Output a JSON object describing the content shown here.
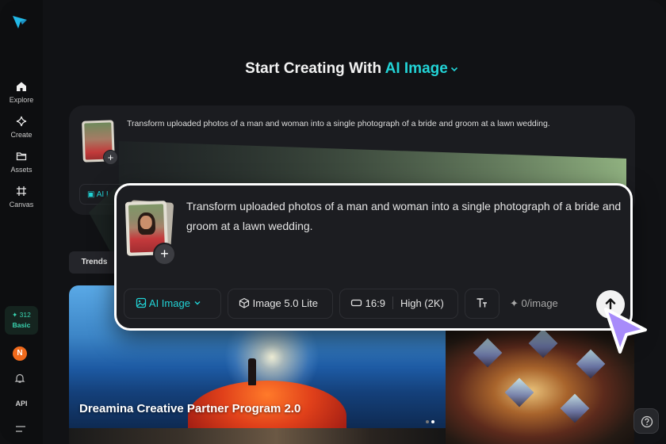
{
  "sidebar": {
    "items": [
      {
        "label": "Explore",
        "icon": "home-icon"
      },
      {
        "label": "Create",
        "icon": "sparkle-icon"
      },
      {
        "label": "Assets",
        "icon": "folder-icon"
      },
      {
        "label": "Canvas",
        "icon": "canvas-icon"
      }
    ],
    "credits": {
      "amount": "312",
      "plan": "Basic"
    },
    "avatar_initial": "N",
    "api_label": "API"
  },
  "header": {
    "title_prefix": "Start Creating With",
    "title_accent": "AI Image"
  },
  "background_card": {
    "prompt": "Transform uploaded photos of a man and woman into a single photograph of a bride and groom at a lawn wedding.",
    "mode_label": "AI I"
  },
  "tabs": {
    "trends": "Trends"
  },
  "gallery": {
    "hero_title": "Dreamina Creative Partner Program 2.0"
  },
  "prompt_card": {
    "prompt": "Transform uploaded photos of a man and woman into a single photograph of a bride and groom at a lawn wedding.",
    "mode": "AI Image",
    "model": "Image 5.0 Lite",
    "ratio": "16:9",
    "quality": "High (2K)",
    "cost": "0/image"
  },
  "colors": {
    "accent": "#22d3d6",
    "credits_text": "#3ad6b2",
    "avatar": "#f06a1c",
    "cursor": "#a78bfa"
  }
}
